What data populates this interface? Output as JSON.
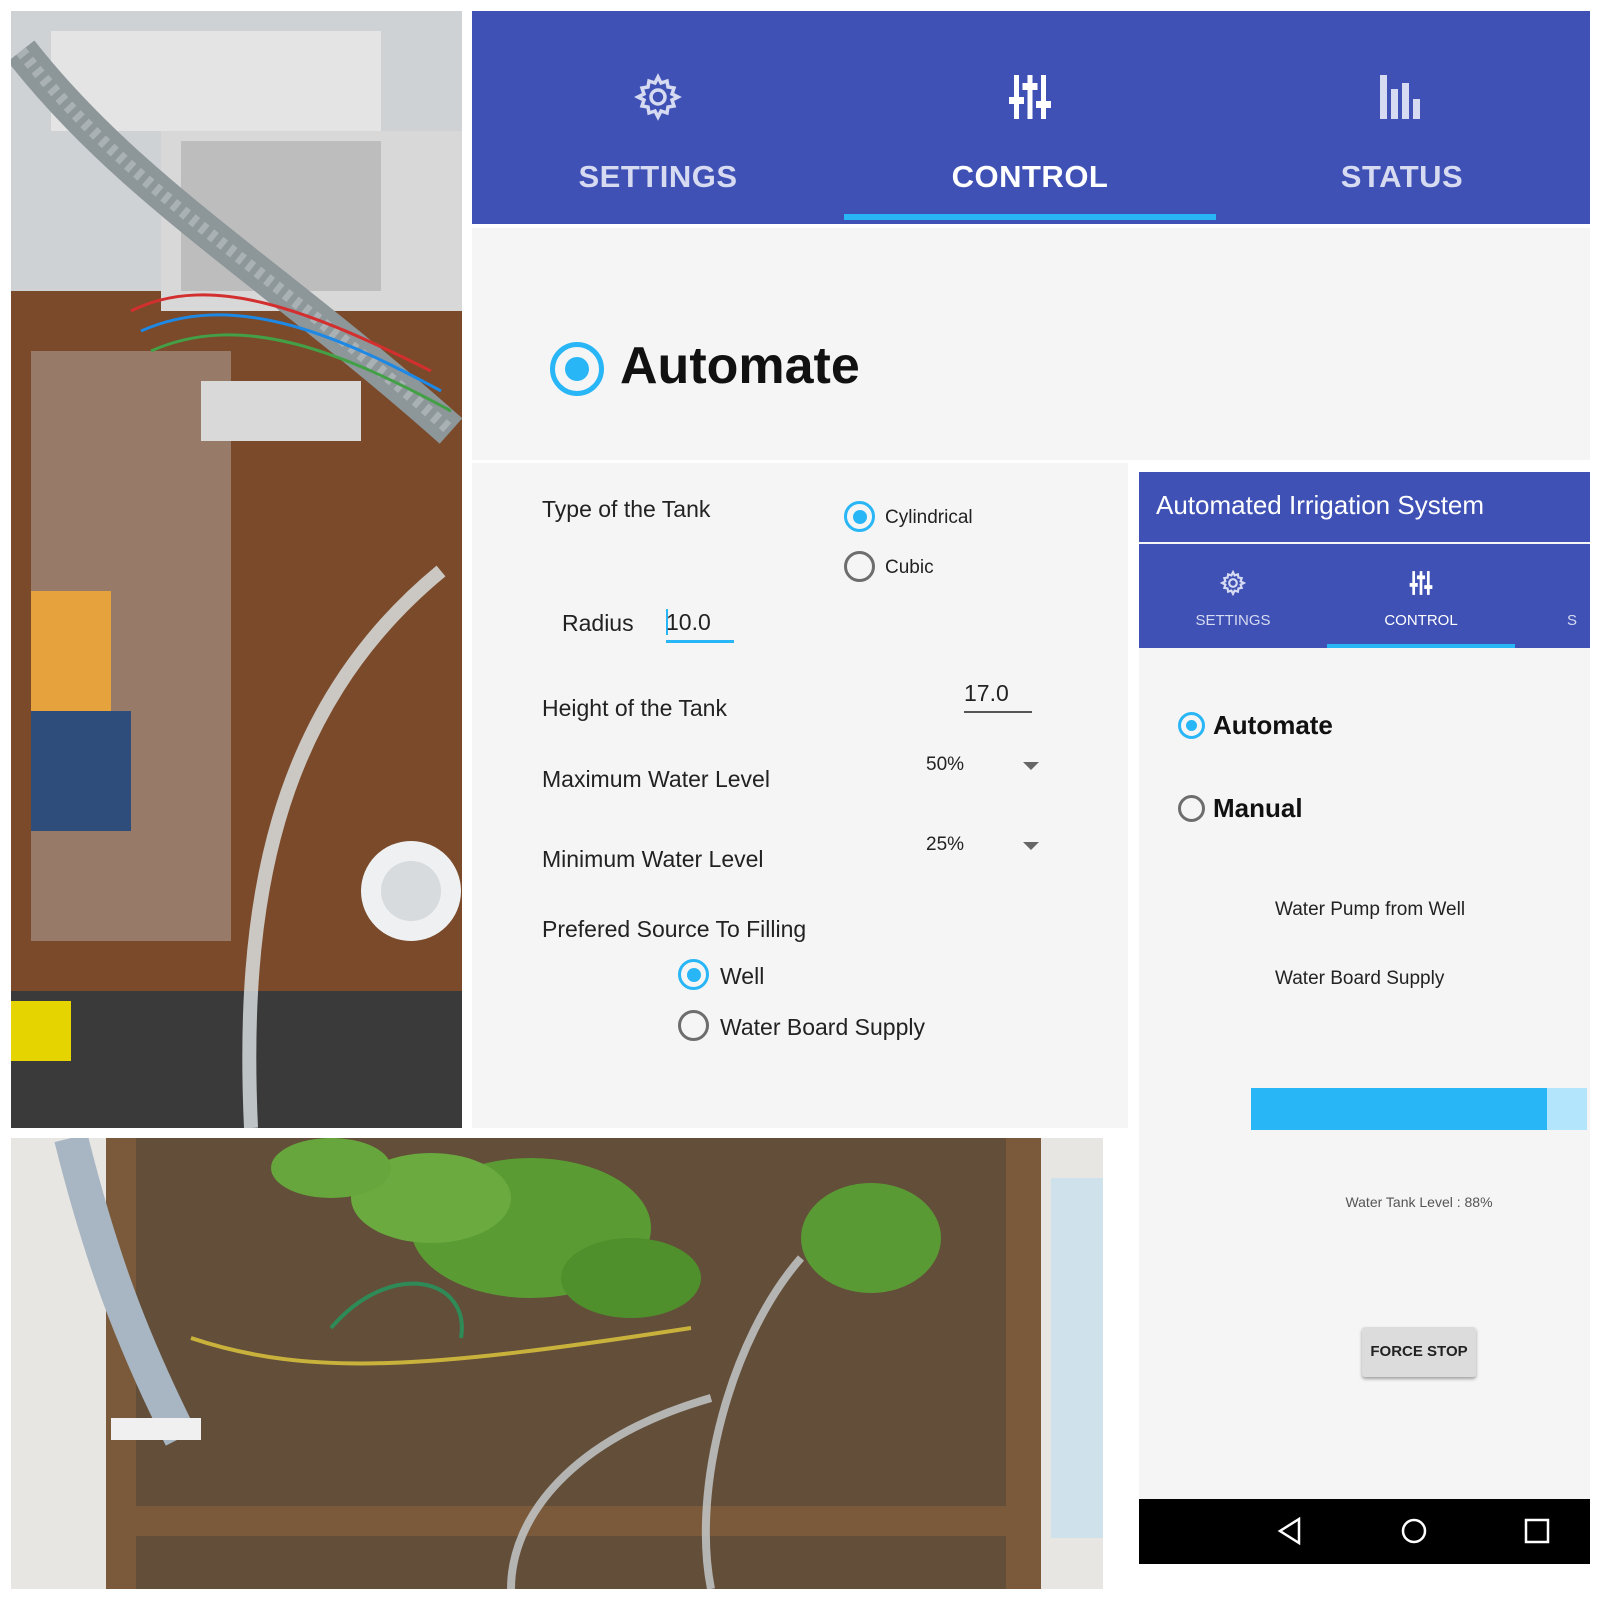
{
  "top_tabs": [
    {
      "label": "SETTINGS",
      "icon": "gear-icon",
      "active": false
    },
    {
      "label": "CONTROL",
      "icon": "sliders-icon",
      "active": true
    },
    {
      "label": "STATUS",
      "icon": "bar-chart-icon",
      "active": false
    }
  ],
  "big_mode": {
    "label": "Automate",
    "selected": true
  },
  "settings_form": {
    "tank_type_label": "Type of the Tank",
    "tank_type_options": [
      {
        "label": "Cylindrical",
        "selected": true
      },
      {
        "label": "Cubic",
        "selected": false
      }
    ],
    "radius_label": "Radius",
    "radius_value": "10.0",
    "height_label": "Height of the Tank",
    "height_value": "17.0",
    "max_level_label": "Maximum Water Level",
    "max_level_value": "50%",
    "min_level_label": "Minimum Water Level",
    "min_level_value": "25%",
    "source_label": "Prefered Source To Filling",
    "source_options": [
      {
        "label": "Well",
        "selected": true
      },
      {
        "label": "Water Board Supply",
        "selected": false
      }
    ]
  },
  "phone": {
    "app_title": "Automated Irrigation System",
    "tabs": [
      {
        "label": "SETTINGS",
        "icon": "gear-icon",
        "active": false
      },
      {
        "label": "CONTROL",
        "icon": "sliders-icon",
        "active": true
      },
      {
        "label": "S",
        "active": false
      }
    ],
    "modes": [
      {
        "label": "Automate",
        "selected": true
      },
      {
        "label": "Manual",
        "selected": false
      }
    ],
    "pump_well_label": "Water Pump from Well",
    "board_supply_label": "Water Board Supply",
    "tank_level_fraction": 0.88,
    "tank_level_text": "Water Tank Level : 88%",
    "force_stop_label": "FORCE STOP",
    "nav_buttons": [
      "back-icon",
      "home-icon",
      "recents-icon"
    ]
  },
  "colors": {
    "primary": "#3f51b5",
    "accent": "#29b6f6",
    "background": "#f5f5f5"
  }
}
